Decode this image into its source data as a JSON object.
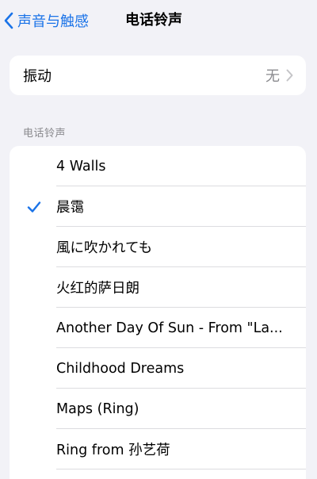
{
  "nav": {
    "back_label": "声音与触感",
    "title": "电话铃声"
  },
  "vibration": {
    "label": "振动",
    "value": "无"
  },
  "ringtones": {
    "section_header": "电话铃声",
    "selected_index": 1,
    "items": [
      {
        "label": "4 Walls"
      },
      {
        "label": "晨霭"
      },
      {
        "label": "風に吹かれても"
      },
      {
        "label": "火红的萨日朗"
      },
      {
        "label": "Another Day Of Sun - From \"La..."
      },
      {
        "label": "Childhood Dreams"
      },
      {
        "label": "Maps (Ring)"
      },
      {
        "label": "Ring from 孙艺荷"
      }
    ]
  },
  "colors": {
    "accent": "#1a73e8",
    "background": "#f2f2f7",
    "secondary_text": "#8a8a8e"
  }
}
